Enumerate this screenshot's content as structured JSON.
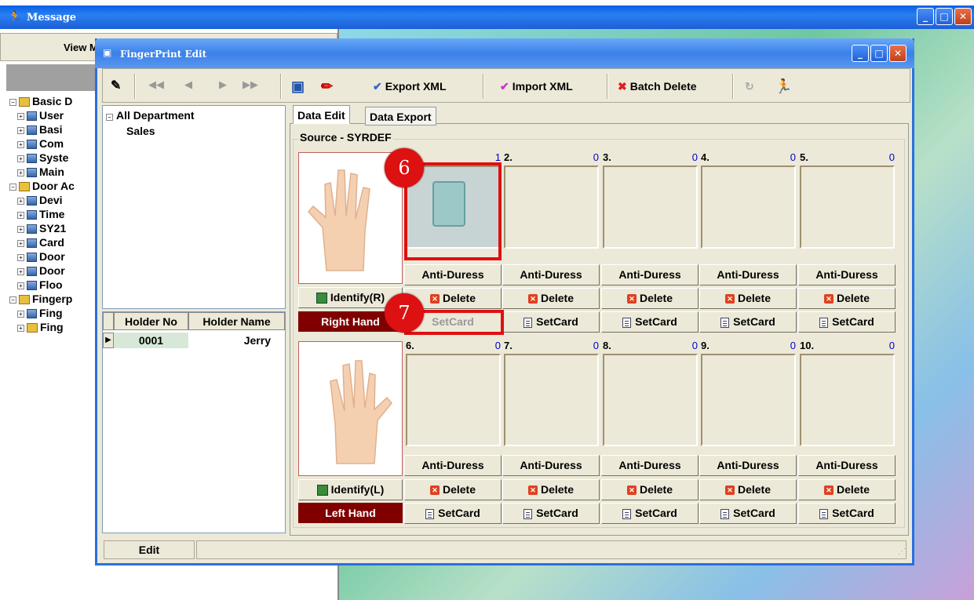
{
  "back_window": {
    "title": "Message",
    "view_mode": "View Mo"
  },
  "back_tree": [
    "Basic D",
    "User",
    "Basi",
    "Com",
    "Syste",
    "Main",
    "Door Ac",
    "Devi",
    "Time",
    "SY21",
    "Card",
    "Door",
    "Door",
    "Floo",
    "Fingerp",
    "Fing",
    "Fing"
  ],
  "window": {
    "title": "FingerPrint Edit"
  },
  "toolbar": {
    "export": "Export XML",
    "import": "Import XML",
    "batch_delete": "Batch Delete"
  },
  "dept_tree": {
    "root": "All Department",
    "child": "Sales"
  },
  "holders": {
    "col_no": "Holder No",
    "col_name": "Holder Name",
    "rows": [
      {
        "no": "0001",
        "name": "Jerry"
      }
    ]
  },
  "tabs": {
    "edit": "Data Edit",
    "export": "Data Export"
  },
  "source": "Source - SYRDEF",
  "right_hand": {
    "identify": "Identify(R)",
    "label": "Right Hand"
  },
  "left_hand": {
    "identify": "Identify(L)",
    "label": "Left Hand"
  },
  "fingers_top": [
    {
      "num": "1.",
      "count": "1"
    },
    {
      "num": "2.",
      "count": "0"
    },
    {
      "num": "3.",
      "count": "0"
    },
    {
      "num": "4.",
      "count": "0"
    },
    {
      "num": "5.",
      "count": "0"
    }
  ],
  "fingers_bottom": [
    {
      "num": "6.",
      "count": "0"
    },
    {
      "num": "7.",
      "count": "0"
    },
    {
      "num": "8.",
      "count": "0"
    },
    {
      "num": "9.",
      "count": "0"
    },
    {
      "num": "10.",
      "count": "0"
    }
  ],
  "buttons": {
    "anti_duress": "Anti-Duress",
    "delete": "Delete",
    "setcard": "SetCard"
  },
  "callouts": {
    "a": "6",
    "b": "7"
  },
  "status": {
    "mode": "Edit"
  },
  "colors": {
    "hand_label_bg": "#800000",
    "callout": "#dd1111"
  }
}
